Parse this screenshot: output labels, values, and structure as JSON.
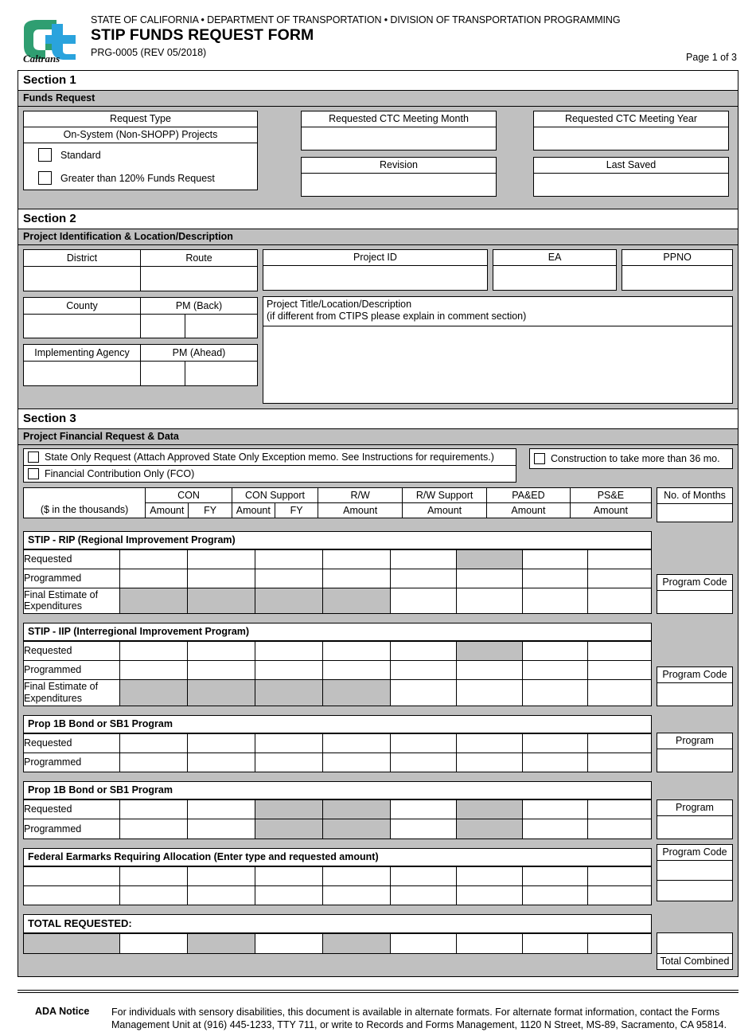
{
  "header": {
    "agency_line": "STATE OF CALIFORNIA • DEPARTMENT OF TRANSPORTATION • DIVISION OF TRANSPORTATION PROGRAMMING",
    "form_title": "STIP FUNDS REQUEST FORM",
    "form_number": "PRG-0005 (REV 05/2018)",
    "page_of": "Page 1 of 3",
    "logo_alt": "caltrans-logo",
    "logo_wordmark": "Caltrans"
  },
  "section1": {
    "section_label": "Section 1",
    "sub_label": "Funds Request",
    "request_type_header": "Request Type",
    "request_type_sub": "On-System (Non-SHOPP) Projects",
    "checkboxes": [
      {
        "label": "Standard",
        "checked": false
      },
      {
        "label": "Greater than 120% Funds Request",
        "checked": false
      }
    ],
    "fields": [
      {
        "label": "Requested CTC Meeting Month",
        "value": ""
      },
      {
        "label": "Requested CTC Meeting Year",
        "value": ""
      },
      {
        "label": "Revision",
        "value": ""
      },
      {
        "label": "Last Saved",
        "value": ""
      }
    ]
  },
  "section2": {
    "section_label": "Section 2",
    "sub_label": "Project Identification & Location/Description",
    "left_fields": [
      {
        "label": "District",
        "value": ""
      },
      {
        "label": "Route",
        "value": ""
      },
      {
        "label": "County",
        "value": ""
      },
      {
        "label": "PM (Back)",
        "value": "",
        "value2": ""
      },
      {
        "label": "Implementing Agency",
        "value": ""
      },
      {
        "label": "PM (Ahead)",
        "value": "",
        "value2": ""
      }
    ],
    "id_fields": [
      {
        "label": "Project ID",
        "value": ""
      },
      {
        "label": "EA",
        "value": ""
      },
      {
        "label": "PPNO",
        "value": ""
      }
    ],
    "description": {
      "line1": "Project Title/Location/Description",
      "line2": "(if different from CTIPS please explain in comment section)",
      "value": ""
    }
  },
  "section3": {
    "section_label": "Section 3",
    "sub_label": "Project Financial Request & Data",
    "checkboxes": [
      {
        "label": "State Only Request (Attach Approved State Only Exception memo. See Instructions for requirements.)",
        "checked": false
      },
      {
        "label": "Financial Contribution Only (FCO)",
        "checked": false
      },
      {
        "label": "Construction to take more than 36 mo.",
        "checked": false
      }
    ],
    "table_header": {
      "units_label": "($ in the thousands)",
      "groups": [
        {
          "label": "CON",
          "cols": [
            "Amount",
            "FY"
          ]
        },
        {
          "label": "CON Support",
          "cols": [
            "Amount",
            "FY"
          ]
        }
      ],
      "single_cols": [
        {
          "line1": "R/W",
          "line2": "Amount"
        },
        {
          "line1": "R/W Support",
          "line2": "Amount"
        },
        {
          "line1": "PA&ED",
          "line2": "Amount"
        },
        {
          "line1": "PS&E",
          "line2": "Amount"
        }
      ],
      "months_label": "No. of Months",
      "months_value": ""
    },
    "blocks": [
      {
        "title": "STIP - RIP (Regional Improvement Program)",
        "rows": [
          {
            "label": "Requested",
            "cells": [
              "",
              "",
              "",
              "",
              "",
              "",
              "",
              ""
            ],
            "gray": [
              5
            ]
          },
          {
            "label": "Programmed",
            "cells": [
              "",
              "",
              "",
              "",
              "",
              "",
              "",
              ""
            ],
            "gray": []
          },
          {
            "label": "Final Estimate of Expenditures",
            "cells": [
              "",
              "",
              "",
              "",
              "",
              "",
              "",
              ""
            ],
            "gray": [
              0,
              1,
              2,
              3
            ],
            "tall": true
          }
        ],
        "side": {
          "label": "Program Code",
          "value": ""
        }
      },
      {
        "title": "STIP - IIP (Interregional Improvement Program)",
        "rows": [
          {
            "label": "Requested",
            "cells": [
              "",
              "",
              "",
              "",
              "",
              "",
              "",
              ""
            ],
            "gray": [
              5
            ]
          },
          {
            "label": "Programmed",
            "cells": [
              "",
              "",
              "",
              "",
              "",
              "",
              "",
              ""
            ],
            "gray": []
          },
          {
            "label": "Final Estimate of Expenditures",
            "cells": [
              "",
              "",
              "",
              "",
              "",
              "",
              "",
              ""
            ],
            "gray": [
              0,
              1,
              2,
              3
            ],
            "tall": true
          }
        ],
        "side": {
          "label": "Program Code",
          "value": ""
        }
      },
      {
        "title": "Prop 1B Bond or SB1 Program",
        "rows": [
          {
            "label": "Requested",
            "cells": [
              "",
              "",
              "",
              "",
              "",
              "",
              "",
              ""
            ],
            "gray": []
          },
          {
            "label": "Programmed",
            "cells": [
              "",
              "",
              "",
              "",
              "",
              "",
              "",
              ""
            ],
            "gray": []
          }
        ],
        "side": {
          "label": "Program",
          "value": ""
        }
      },
      {
        "title": "Prop 1B Bond or SB1 Program",
        "rows": [
          {
            "label": "Requested",
            "cells": [
              "",
              "",
              "",
              "",
              "",
              "",
              "",
              ""
            ],
            "gray": [
              2,
              3,
              5
            ]
          },
          {
            "label": "Programmed",
            "cells": [
              "",
              "",
              "",
              "",
              "",
              "",
              "",
              ""
            ],
            "gray": [
              2,
              3,
              5
            ]
          }
        ],
        "side": {
          "label": "Program",
          "value": ""
        }
      }
    ],
    "earmarks": {
      "title": "Federal Earmarks Requiring Allocation (Enter type and requested amount)",
      "rows": [
        {
          "cells": [
            "",
            "",
            "",
            "",
            "",
            "",
            "",
            "",
            ""
          ],
          "gray": []
        },
        {
          "cells": [
            "",
            "",
            "",
            "",
            "",
            "",
            "",
            "",
            ""
          ],
          "gray": []
        }
      ],
      "side": {
        "label": "Program Code",
        "value1": "",
        "value2": ""
      }
    },
    "total": {
      "title": "TOTAL REQUESTED:",
      "row": {
        "cells": [
          "",
          "",
          "",
          "",
          "",
          "",
          "",
          "",
          ""
        ],
        "gray": [
          0,
          2,
          4
        ]
      },
      "combined_label": "Total Combined",
      "combined_value": ""
    }
  },
  "footer": {
    "ada_label": "ADA Notice",
    "ada_text": "For individuals with sensory disabilities, this document is available in alternate formats. For alternate format information, contact the Forms Management Unit at (916) 445-1233, TTY 711, or write to Records and Forms Management, 1120 N Street, MS-89, Sacramento, CA 95814."
  },
  "colors": {
    "gray_fill": "#c0c0c0",
    "logo_green": "#2f9e71",
    "logo_blue": "#2aa3dd",
    "border": "#000000"
  }
}
